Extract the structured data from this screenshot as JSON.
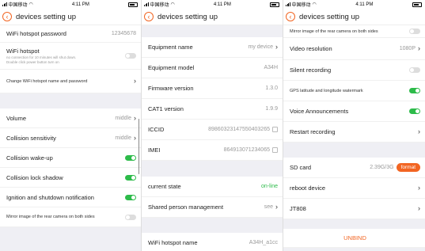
{
  "status": {
    "carrier": "中国移动",
    "time": "4:11 PM"
  },
  "nav": {
    "title": "devices setting up"
  },
  "screen1": {
    "wifi_password_label": "WiFi hotspot password",
    "wifi_password_value": "12345678",
    "wifi_hotspot_label": "WiFi hotspot",
    "wifi_hotspot_note": "no connection for 10 minutes will shut down.\nDouble click power button turn on",
    "change_wifi_label": "Change WiFi hotspot name and password",
    "volume_label": "Volume",
    "volume_value": "middle",
    "collision_sensitivity_label": "Collision sensitivity",
    "collision_sensitivity_value": "middle",
    "collision_wakeup_label": "Collision wake-up",
    "collision_lock_label": "Collision lock shadow",
    "ignition_label": "Ignition and shutdown notification",
    "mirror_label": "Mirror image of the rear camera on both sides"
  },
  "screen2": {
    "equipment_name_label": "Equipment name",
    "equipment_name_value": "my device",
    "equipment_model_label": "Equipment model",
    "equipment_model_value": "A34H",
    "firmware_label": "Firmware version",
    "firmware_value": "1.3.0",
    "cat1_label": "CAT1 version",
    "cat1_value": "1.9.9",
    "iccid_label": "ICCID",
    "iccid_value": "89860323147550403265",
    "imei_label": "IMEI",
    "imei_value": "864913071234065",
    "current_state_label": "current state",
    "current_state_value": "on-line",
    "shared_label": "Shared person management",
    "shared_value": "see",
    "wifi_name_label": "WiFi hotspot name",
    "wifi_name_value": "A34H_a1cc"
  },
  "screen3": {
    "mirror_label": "Mirror image of the rear camera on both sides",
    "video_resolution_label": "Video resolution",
    "video_resolution_value": "1080P",
    "silent_recording_label": "Silent recording",
    "gps_label": "GPS latitude and longitude watermark",
    "voice_label": "Voice Announcements",
    "restart_label": "Restart recording",
    "sd_card_label": "SD card",
    "sd_card_value": "2.39G/3G",
    "format_label": "format",
    "reboot_label": "reboot device",
    "jt808_label": "JT808",
    "unbind_label": "UNBIND"
  },
  "toggles": {
    "s1_wifi_hotspot": false,
    "s1_collision_wakeup": true,
    "s1_collision_lock": true,
    "s1_ignition": true,
    "s1_mirror": false,
    "s3_mirror": false,
    "s3_silent": false,
    "s3_gps": true,
    "s3_voice": true
  },
  "colors": {
    "accent": "#f26522",
    "toggle_on": "#2dbb4a",
    "toggle_off": "#dddddd"
  }
}
